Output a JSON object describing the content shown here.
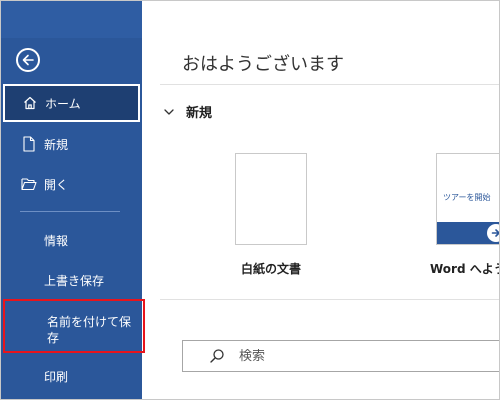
{
  "sidebar": {
    "home_label": "ホーム",
    "new_label": "新規",
    "open_label": "開く",
    "info_label": "情報",
    "save_label": "上書き保存",
    "save_as_label": "名前を付けて保存",
    "print_label": "印刷"
  },
  "main": {
    "greeting": "おはようございます",
    "new_section_title": "新規",
    "templates": [
      {
        "label": "白紙の文書"
      },
      {
        "label": "Word へよう",
        "thumb_text": "ツアーを開始"
      }
    ],
    "search_placeholder": "検索"
  },
  "colors": {
    "sidebar_bg": "#2b579a",
    "highlight_border": "#e8141c"
  }
}
